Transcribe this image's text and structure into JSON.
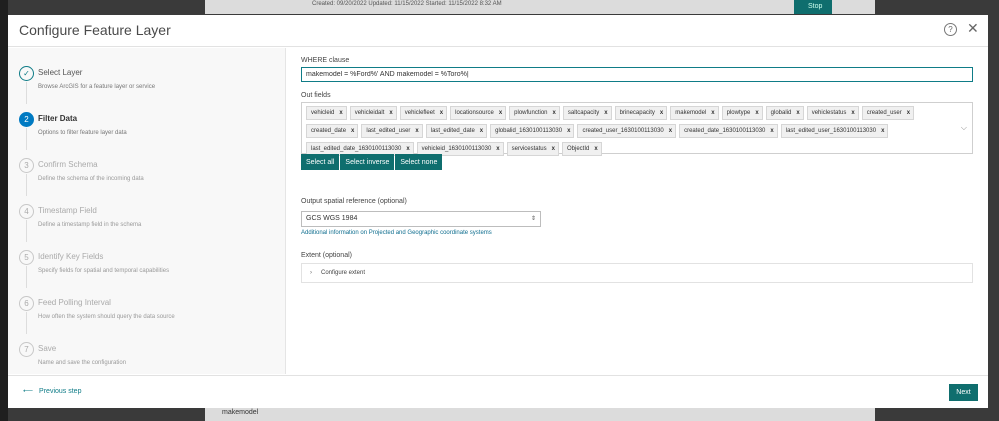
{
  "background": {
    "top_text": "Created: 09/20/2022   Updated: 11/15/2022   Started: 11/15/2022 8:32 AM",
    "stop_label": "Stop",
    "bottom_text": "makemodel"
  },
  "modal": {
    "title": "Configure Feature Layer",
    "help_icon": "help-icon",
    "close_icon": "close-icon"
  },
  "steps": [
    {
      "number": "✓",
      "title": "Select Layer",
      "desc": "Browse ArcGIS for a feature layer or service",
      "state": "done"
    },
    {
      "number": "2",
      "title": "Filter Data",
      "desc": "Options to filter feature layer data",
      "state": "active"
    },
    {
      "number": "3",
      "title": "Confirm Schema",
      "desc": "Define the schema of the incoming data",
      "state": "pending"
    },
    {
      "number": "4",
      "title": "Timestamp Field",
      "desc": "Define a timestamp field in the schema",
      "state": "pending"
    },
    {
      "number": "5",
      "title": "Identify Key Fields",
      "desc": "Specify fields for spatial and temporal capabilities",
      "state": "pending"
    },
    {
      "number": "6",
      "title": "Feed Polling Interval",
      "desc": "How often the system should query the data source",
      "state": "pending"
    },
    {
      "number": "7",
      "title": "Save",
      "desc": "Name and save the configuration",
      "state": "pending"
    }
  ],
  "where": {
    "label": "WHERE clause",
    "value": "makemodel = %Ford%' AND makemodel = %Toro%|"
  },
  "outfields": {
    "label": "Out fields",
    "fields": [
      "vehicleid",
      "vehicleidalt",
      "vehiclefleet",
      "locationsource",
      "plowfunction",
      "saltcapacity",
      "brinecapacity",
      "makemodel",
      "plowtype",
      "globalid",
      "vehiclestatus",
      "created_user",
      "created_date",
      "last_edited_user",
      "last_edited_date",
      "globalid_1630100113030",
      "created_user_1630100113030",
      "created_date_1630100113030",
      "last_edited_user_1630100113030",
      "last_edited_date_1630100113030",
      "vehicleid_1630100113030",
      "servicestatus",
      "ObjectId"
    ],
    "remove_icon": "x",
    "select_all": "Select all",
    "select_inverse": "Select inverse",
    "select_none": "Select none"
  },
  "spatial_ref": {
    "label": "Output spatial reference (optional)",
    "value": "GCS WGS 1984",
    "link": "Additional information on Projected and Geographic coordinate systems"
  },
  "extent": {
    "label": "Extent (optional)",
    "toggle_label": "Configure extent"
  },
  "footer": {
    "previous": "Previous step",
    "next": "Next"
  },
  "colors": {
    "accent": "#0f6e6e",
    "active_step": "#007ac2"
  }
}
